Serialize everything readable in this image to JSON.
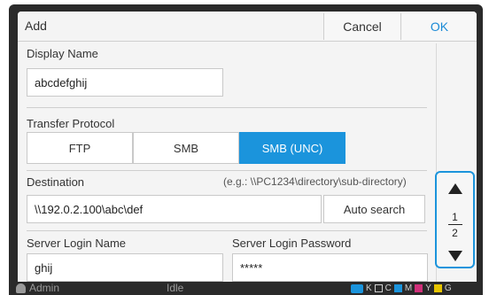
{
  "dialog": {
    "title": "Add",
    "cancel_label": "Cancel",
    "ok_label": "OK"
  },
  "display_name": {
    "label": "Display Name",
    "value": "abcdefghij"
  },
  "transfer_protocol": {
    "label": "Transfer Protocol",
    "options": [
      "FTP",
      "SMB",
      "SMB (UNC)"
    ],
    "selected": "SMB (UNC)"
  },
  "destination": {
    "label": "Destination",
    "hint": "(e.g.: \\\\PC1234\\directory\\sub-directory)",
    "value": "\\\\192.0.2.100\\abc\\def",
    "auto_search_label": "Auto search"
  },
  "server_login_name": {
    "label": "Server Login Name",
    "value": "ghij"
  },
  "server_login_password": {
    "label": "Server Login Password",
    "value": "*****"
  },
  "pager": {
    "current": "1",
    "total": "2"
  },
  "status": {
    "user": "Admin",
    "state": "Idle",
    "ink": [
      "K",
      "C",
      "M",
      "Y",
      "G"
    ]
  },
  "colors": {
    "accent": "#1b94dc",
    "ok_text": "#1a8ad6"
  }
}
